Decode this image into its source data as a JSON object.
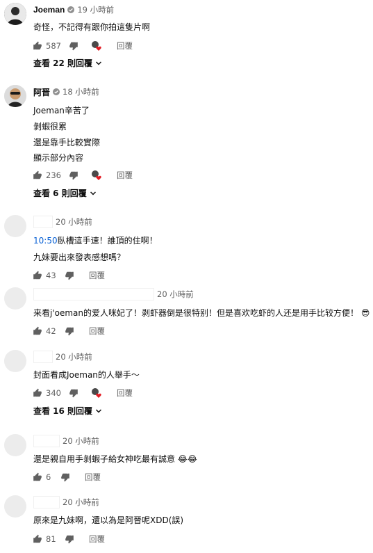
{
  "comments": [
    {
      "author": "Joeman",
      "time": "19 小時前",
      "lines": [
        "奇怪，不記得有跟你拍這隻片啊"
      ],
      "likes": "587",
      "creator_heart": true,
      "reply_label": "回覆",
      "view_replies": "查看 22 則回覆"
    },
    {
      "author": "阿晋",
      "time": "18 小時前",
      "lines": [
        "Joeman辛苦了",
        "剝蝦很累",
        "還是靠手比較實際",
        "顯示部分內容"
      ],
      "likes": "236",
      "creator_heart": true,
      "reply_label": "回覆",
      "view_replies": "查看 6 則回覆"
    },
    {
      "author": "",
      "time": "20 小時前",
      "timestamp_link": "10:50",
      "lines": [
        "臥槽這手速！誰頂的住啊！",
        "九妹要出來發表感想嗎？"
      ],
      "likes": "43",
      "reply_label": "回覆"
    },
    {
      "author": "",
      "time": "20 小時前",
      "lines": [
        "来看j'oeman的爱人咪妃了！剥虾器倒是很特别！但是喜欢吃虾的人还是用手比较方便！"
      ],
      "emoji": "😎",
      "likes": "42",
      "reply_label": "回覆"
    },
    {
      "author": "",
      "time": "20 小時前",
      "lines": [
        "封面看成Joeman的人舉手～"
      ],
      "likes": "340",
      "creator_heart": true,
      "reply_label": "回覆",
      "view_replies": "查看 16 則回覆"
    },
    {
      "author": "",
      "time": "20 小時前",
      "lines": [
        "還是親自用手剝蝦子給女神吃最有誠意"
      ],
      "emoji": "😂😂",
      "likes": "6",
      "reply_label": "回覆"
    },
    {
      "author": "",
      "time": "20 小時前",
      "lines": [
        "原來是九妹啊，還以為是阿晉呢XDD(誤)"
      ],
      "likes": "81",
      "reply_label": "回覆"
    }
  ],
  "colors": {
    "text": "#0f0f0f",
    "meta": "#606060",
    "link": "#065fd4",
    "heart": "#e31b23",
    "avatar_placeholder": "#ececec"
  }
}
